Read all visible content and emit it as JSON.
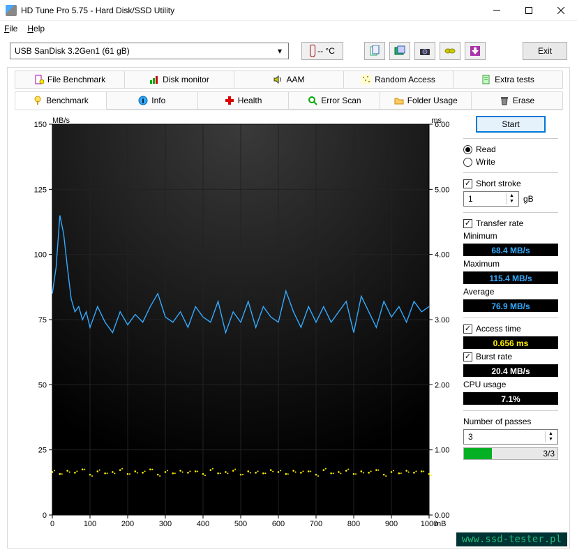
{
  "window": {
    "title": "HD Tune Pro 5.75 - Hard Disk/SSD Utility"
  },
  "menu": {
    "file": "File",
    "help": "Help"
  },
  "drive_combo": {
    "value": "USB SanDisk 3.2Gen1 (61 gB)"
  },
  "temperature": {
    "value": "-- °C"
  },
  "toolbar": {
    "exit": "Exit"
  },
  "tabs_top": [
    {
      "label": "File Benchmark"
    },
    {
      "label": "Disk monitor"
    },
    {
      "label": "AAM"
    },
    {
      "label": "Random Access"
    },
    {
      "label": "Extra tests"
    }
  ],
  "tabs_bottom": [
    {
      "label": "Benchmark",
      "active": true
    },
    {
      "label": "Info"
    },
    {
      "label": "Health"
    },
    {
      "label": "Error Scan"
    },
    {
      "label": "Folder Usage"
    },
    {
      "label": "Erase"
    }
  ],
  "side": {
    "start": "Start",
    "read": "Read",
    "write": "Write",
    "short_stroke": "Short stroke",
    "short_stroke_val": "1",
    "short_stroke_unit": "gB",
    "transfer_rate": "Transfer rate",
    "minimum": "Minimum",
    "min_val": "68.4 MB/s",
    "maximum": "Maximum",
    "max_val": "115.4 MB/s",
    "average": "Average",
    "avg_val": "76.9 MB/s",
    "access_time": "Access time",
    "access_val": "0.656 ms",
    "burst_rate": "Burst rate",
    "burst_val": "20.4 MB/s",
    "cpu_usage": "CPU usage",
    "cpu_val": "7.1%",
    "passes_label": "Number of passes",
    "passes_val": "3",
    "progress": "3/3"
  },
  "watermark": "www.ssd-tester.pl",
  "chart_data": {
    "type": "line",
    "title": "",
    "x_axis": {
      "label": "mB",
      "min": 0,
      "max": 1000,
      "ticks": [
        0,
        100,
        200,
        300,
        400,
        500,
        600,
        700,
        800,
        900,
        1000
      ]
    },
    "y_left": {
      "label": "MB/s",
      "min": 0,
      "max": 150,
      "ticks": [
        0,
        25,
        50,
        75,
        100,
        125,
        150
      ]
    },
    "y_right": {
      "label": "ms",
      "min": 0,
      "max": 6.0,
      "ticks": [
        0,
        1.0,
        2.0,
        3.0,
        4.0,
        5.0,
        6.0
      ]
    },
    "series": [
      {
        "name": "Transfer rate",
        "axis": "left",
        "color": "#33aaff",
        "x": [
          0,
          10,
          20,
          30,
          40,
          50,
          60,
          70,
          80,
          90,
          100,
          120,
          140,
          160,
          180,
          200,
          220,
          240,
          260,
          280,
          300,
          320,
          340,
          360,
          380,
          400,
          420,
          440,
          460,
          480,
          500,
          520,
          540,
          560,
          580,
          600,
          620,
          640,
          660,
          680,
          700,
          720,
          740,
          760,
          780,
          800,
          820,
          840,
          860,
          880,
          900,
          920,
          940,
          960,
          980,
          1000
        ],
        "y": [
          85,
          95,
          115,
          108,
          95,
          83,
          78,
          80,
          75,
          78,
          72,
          80,
          74,
          70,
          78,
          73,
          77,
          74,
          80,
          85,
          76,
          74,
          78,
          72,
          80,
          76,
          74,
          82,
          70,
          78,
          74,
          82,
          72,
          80,
          76,
          74,
          86,
          78,
          72,
          80,
          74,
          80,
          74,
          78,
          82,
          70,
          84,
          78,
          72,
          82,
          76,
          80,
          74,
          82,
          78,
          80
        ]
      },
      {
        "name": "Access time",
        "axis": "right",
        "color": "#ffee00",
        "type": "scatter",
        "x": [
          0,
          20,
          40,
          60,
          80,
          100,
          120,
          140,
          160,
          180,
          200,
          220,
          240,
          260,
          280,
          300,
          320,
          340,
          360,
          380,
          400,
          420,
          440,
          460,
          480,
          500,
          520,
          540,
          560,
          580,
          600,
          620,
          640,
          660,
          680,
          700,
          720,
          740,
          760,
          780,
          800,
          820,
          840,
          860,
          880,
          900,
          920,
          940,
          960,
          980,
          1000
        ],
        "y": [
          0.66,
          0.63,
          0.68,
          0.65,
          0.7,
          0.62,
          0.67,
          0.64,
          0.66,
          0.69,
          0.63,
          0.67,
          0.65,
          0.7,
          0.62,
          0.66,
          0.64,
          0.68,
          0.65,
          0.67,
          0.63,
          0.69,
          0.64,
          0.66,
          0.68,
          0.62,
          0.67,
          0.65,
          0.64,
          0.69,
          0.66,
          0.63,
          0.68,
          0.65,
          0.67,
          0.62,
          0.69,
          0.64,
          0.66,
          0.68,
          0.63,
          0.67,
          0.65,
          0.69,
          0.62,
          0.66,
          0.64,
          0.68,
          0.65,
          0.67,
          0.63
        ]
      }
    ]
  }
}
